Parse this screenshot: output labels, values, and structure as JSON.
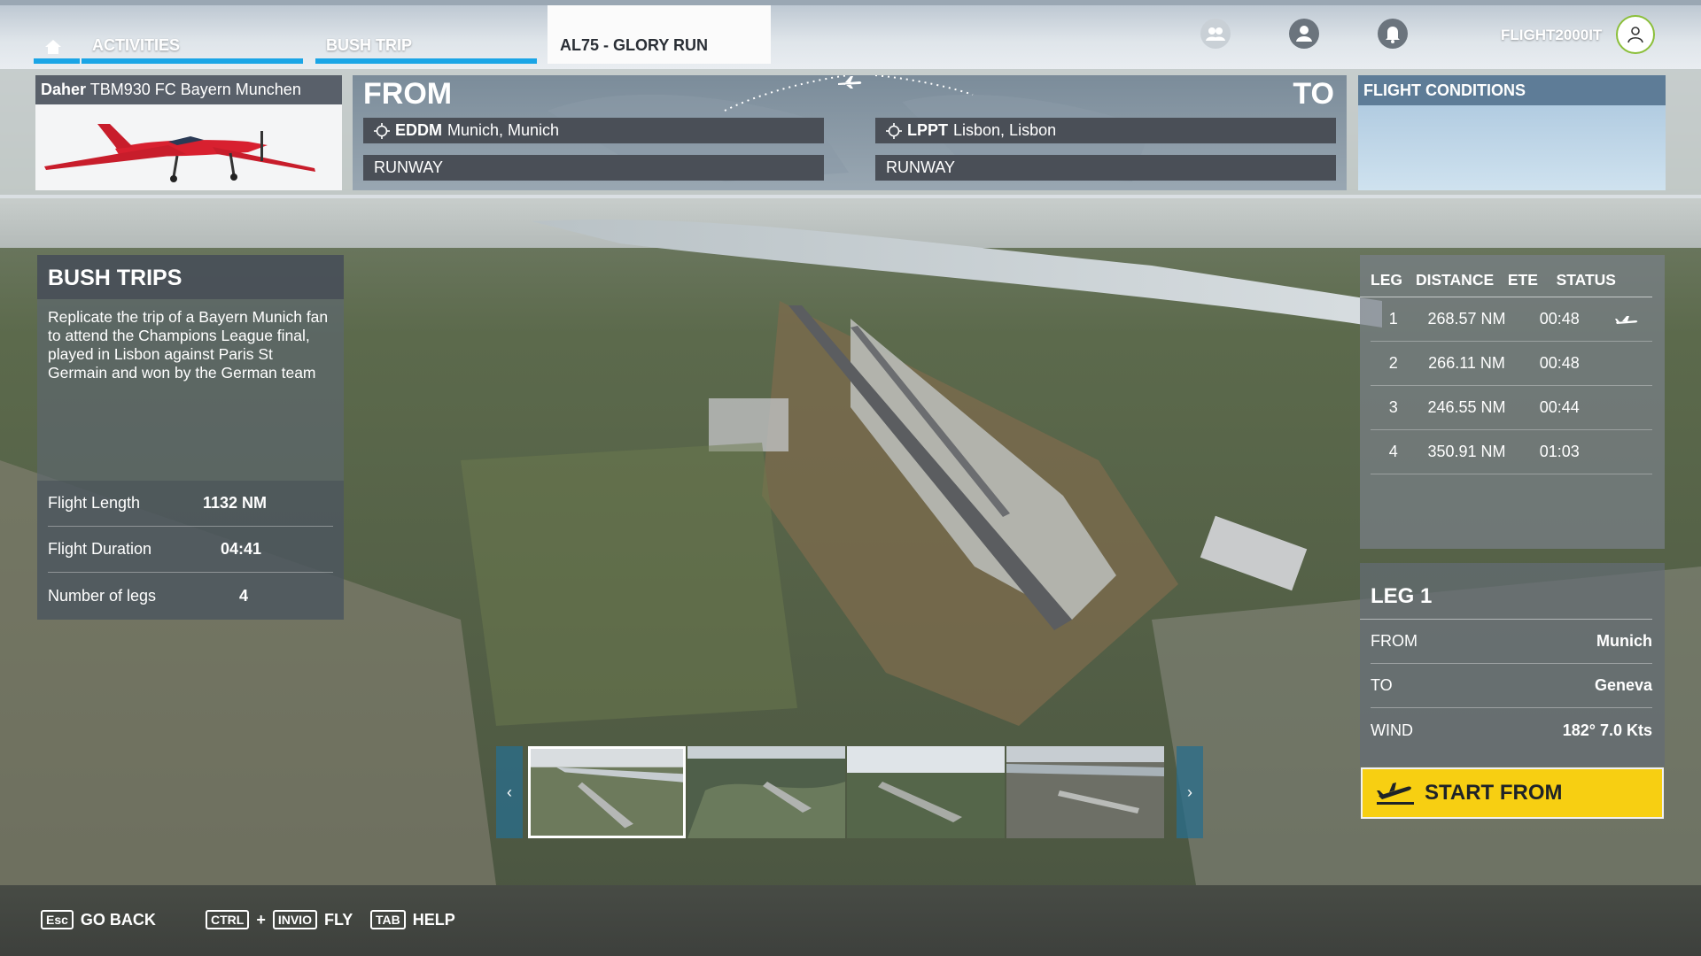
{
  "header": {
    "tabs": [
      {
        "label": "",
        "icon": "home-icon"
      },
      {
        "label": "ACTIVITIES"
      },
      {
        "label": "BUSH TRIP"
      },
      {
        "label": "AL75 - GLORY RUN"
      }
    ],
    "username": "FLIGHT2000IT",
    "icons": [
      "friends-icon",
      "profile-icon",
      "notifications-icon",
      "avatar-icon"
    ],
    "accent_color": "#1aa5e6"
  },
  "aircraft": {
    "maker": "Daher",
    "model": "TBM930 FC Bayern Munchen"
  },
  "route": {
    "from_label": "FROM",
    "to_label": "TO",
    "from": {
      "code": "EDDM",
      "name": "Munich, Munich",
      "runway": "RUNWAY"
    },
    "to": {
      "code": "LPPT",
      "name": "Lisbon, Lisbon",
      "runway": "RUNWAY"
    }
  },
  "conditions": {
    "title": "FLIGHT CONDITIONS"
  },
  "bush_trip": {
    "title": "BUSH TRIPS",
    "description": "Replicate the trip of a Bayern Munich fan to attend the Champions League final, played in Lisbon against Paris St Germain and won by the German team",
    "stats": [
      {
        "label": "Flight Length",
        "value": "1132 NM"
      },
      {
        "label": "Flight Duration",
        "value": "04:41"
      },
      {
        "label": "Number of legs",
        "value": "4"
      }
    ]
  },
  "legs_table": {
    "headers": [
      "LEG",
      "DISTANCE",
      "ETE",
      "STATUS"
    ],
    "rows": [
      {
        "leg": "1",
        "distance": "268.57 NM",
        "ete": "00:48",
        "status_icon": "airplane-icon"
      },
      {
        "leg": "2",
        "distance": "266.11 NM",
        "ete": "00:48",
        "status_icon": ""
      },
      {
        "leg": "3",
        "distance": "246.55 NM",
        "ete": "00:44",
        "status_icon": ""
      },
      {
        "leg": "4",
        "distance": "350.91 NM",
        "ete": "01:03",
        "status_icon": ""
      }
    ]
  },
  "leg_detail": {
    "title": "LEG 1",
    "rows": [
      {
        "label": "FROM",
        "value": "Munich"
      },
      {
        "label": "TO",
        "value": "Geneva"
      },
      {
        "label": "WIND",
        "value": "182° 7.0 Kts"
      }
    ],
    "start_label": "START FROM",
    "start_color": "#f7cf12"
  },
  "thumbnails": {
    "count": 4,
    "selected": 1
  },
  "footer": {
    "hints": [
      {
        "keys": [
          "Esc"
        ],
        "label": "GO BACK"
      },
      {
        "keys": [
          "CTRL",
          "INVIO"
        ],
        "label": "FLY"
      },
      {
        "keys": [
          "TAB"
        ],
        "label": "HELP"
      }
    ]
  }
}
